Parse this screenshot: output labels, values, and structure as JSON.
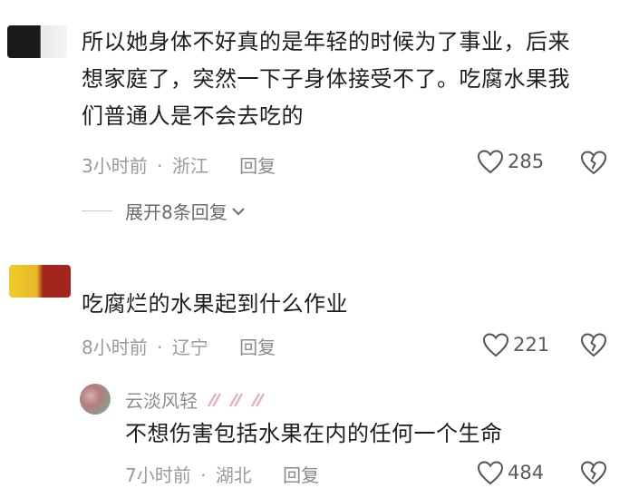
{
  "comments": [
    {
      "text_lines": [
        "所以她身体不好真的是年轻的时候为了事业，后来",
        "想家庭了，突然一下子身体接受不了。吃腐水果我",
        "们普通人是不会去吃的"
      ],
      "time": "3小时前",
      "location": "浙江",
      "reply_label": "回复",
      "likes": "285",
      "expand_label": "展开8条回复"
    },
    {
      "text_lines": [
        "吃腐烂的水果起到什么作业"
      ],
      "time": "8小时前",
      "location": "辽宁",
      "reply_label": "回复",
      "likes": "221"
    }
  ],
  "reply": {
    "username": "云淡风轻",
    "text": "不想伤害包括水果在内的任何一个生命",
    "time": "7小时前",
    "location": "湖北",
    "reply_label": "回复",
    "likes": "484"
  },
  "separator": "·"
}
